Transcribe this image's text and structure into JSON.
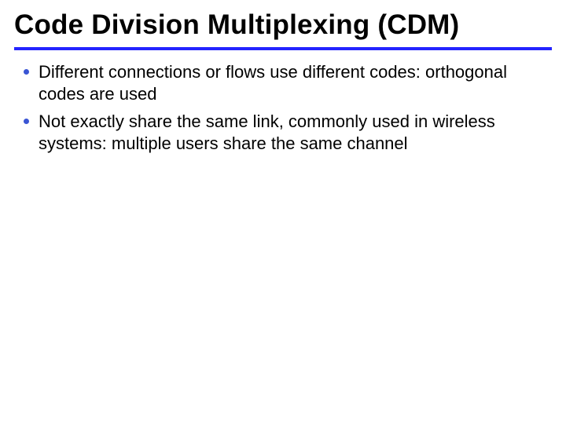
{
  "title": "Code Division Multiplexing (CDM)",
  "bullets": [
    {
      "text": "Different connections or flows use different codes: orthogonal codes are used"
    },
    {
      "text": "Not exactly share the same link, commonly used in wireless systems: multiple users share the same channel"
    }
  ],
  "colors": {
    "rule": "#2424ff",
    "bullet": "#3a55d4"
  }
}
